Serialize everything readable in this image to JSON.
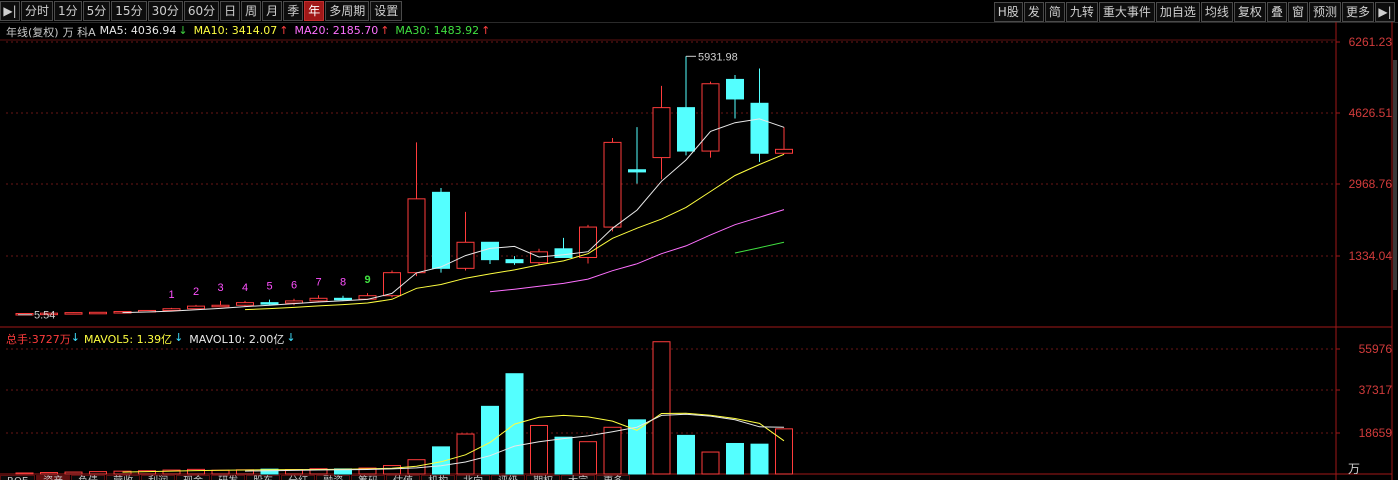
{
  "toolbar": {
    "left": [
      "分时",
      "1分",
      "5分",
      "15分",
      "30分",
      "60分",
      "日",
      "周",
      "月",
      "季",
      "年",
      "多周期",
      "设置"
    ],
    "active": "年",
    "right": [
      "H股",
      "发",
      "简",
      "九转",
      "重大事件",
      "加自选",
      "均线",
      "复权",
      "叠",
      "窗",
      "预测",
      "更多"
    ]
  },
  "main_legend": {
    "label": "年线(复权)",
    "stock": "万 科A",
    "ma": [
      {
        "name": "MA5: ",
        "value": "4036.94",
        "arrow": "↓",
        "color": "#e8e8e8",
        "arrowColor": "#3fd03f"
      },
      {
        "name": "MA10: ",
        "value": "3414.07",
        "arrow": "↑",
        "color": "#ffff40",
        "arrowColor": "#ff4040"
      },
      {
        "name": "MA20: ",
        "value": "2185.70",
        "arrow": "↑",
        "color": "#ff70ff",
        "arrowColor": "#ff4040"
      },
      {
        "name": "MA30: ",
        "value": "1483.92",
        "arrow": "↑",
        "color": "#40e040",
        "arrowColor": "#ff4040"
      }
    ]
  },
  "vol_legend": {
    "label": "总手: ",
    "value": "3727万",
    "items": [
      {
        "name": "MAVOL5: ",
        "value": "1.39亿",
        "arrow": "↓",
        "color": "#ffff40",
        "arrowColor": "#40e0ff"
      },
      {
        "name": "MAVOL10: ",
        "value": "2.00亿",
        "arrow": "↓",
        "color": "#e8e8e8",
        "arrowColor": "#40e0ff"
      }
    ]
  },
  "price_axis": [
    "6261.23",
    "4626.51",
    "2968.76",
    "1334.04"
  ],
  "vol_axis": [
    "55976",
    "37317",
    "18659"
  ],
  "vol_unit": "万",
  "annotations": {
    "high": "5931.98",
    "low": "5.54"
  },
  "counts": [
    "1",
    "2",
    "3",
    "4",
    "5",
    "6",
    "7",
    "8",
    "9"
  ],
  "colors": {
    "up": "#ff3c3c",
    "down": "#54ffff",
    "grid": "#7a1a1a"
  },
  "chart_data": {
    "type": "candlestick",
    "y_axis_ticks": [
      6261.23,
      4626.51,
      2968.76,
      1334.04
    ],
    "ylim": [
      -300,
      6700
    ],
    "candles": [
      {
        "o": 6,
        "h": 12,
        "l": 5.54,
        "c": 10
      },
      {
        "o": 10,
        "h": 22,
        "l": 8,
        "c": 18
      },
      {
        "o": 18,
        "h": 35,
        "l": 15,
        "c": 30
      },
      {
        "o": 30,
        "h": 42,
        "l": 25,
        "c": 38
      },
      {
        "o": 38,
        "h": 60,
        "l": 34,
        "c": 55
      },
      {
        "o": 55,
        "h": 90,
        "l": 50,
        "c": 80
      },
      {
        "o": 80,
        "h": 140,
        "l": 75,
        "c": 120
      },
      {
        "o": 120,
        "h": 210,
        "l": 110,
        "c": 180
      },
      {
        "o": 180,
        "h": 300,
        "l": 160,
        "c": 200
      },
      {
        "o": 200,
        "h": 300,
        "l": 170,
        "c": 260
      },
      {
        "o": 260,
        "h": 330,
        "l": 210,
        "c": 250
      },
      {
        "o": 250,
        "h": 350,
        "l": 200,
        "c": 300
      },
      {
        "o": 300,
        "h": 430,
        "l": 280,
        "c": 360
      },
      {
        "o": 360,
        "h": 420,
        "l": 300,
        "c": 340
      },
      {
        "o": 340,
        "h": 480,
        "l": 330,
        "c": 420
      },
      {
        "o": 420,
        "h": 1000,
        "l": 380,
        "c": 950
      },
      {
        "o": 950,
        "h": 3950,
        "l": 870,
        "c": 2650
      },
      {
        "o": 2800,
        "h": 2900,
        "l": 950,
        "c": 1050
      },
      {
        "o": 1050,
        "h": 2350,
        "l": 1000,
        "c": 1650
      },
      {
        "o": 1650,
        "h": 1600,
        "l": 1150,
        "c": 1250
      },
      {
        "o": 1250,
        "h": 1330,
        "l": 1130,
        "c": 1180
      },
      {
        "o": 1180,
        "h": 1500,
        "l": 1120,
        "c": 1430
      },
      {
        "o": 1500,
        "h": 1750,
        "l": 1380,
        "c": 1300
      },
      {
        "o": 1300,
        "h": 2050,
        "l": 1160,
        "c": 2000
      },
      {
        "o": 2000,
        "h": 4050,
        "l": 1900,
        "c": 3950
      },
      {
        "o": 3320,
        "h": 4300,
        "l": 3000,
        "c": 3270
      },
      {
        "o": 3600,
        "h": 5250,
        "l": 3100,
        "c": 4750
      },
      {
        "o": 4750,
        "h": 5931.98,
        "l": 3650,
        "c": 3750
      },
      {
        "o": 3750,
        "h": 5350,
        "l": 3600,
        "c": 5300
      },
      {
        "o": 5400,
        "h": 5500,
        "l": 4500,
        "c": 4950
      },
      {
        "o": 4850,
        "h": 5650,
        "l": 3500,
        "c": 3700
      },
      {
        "o": 3700,
        "h": 4300,
        "l": 3680,
        "c": 3790
      }
    ],
    "volumes": [
      900,
      1100,
      1300,
      1500,
      1700,
      1900,
      2200,
      2500,
      2100,
      2300,
      2600,
      2400,
      2800,
      2700,
      3100,
      4200,
      6800,
      12500,
      18200,
      30500,
      45000,
      22000,
      16800,
      14800,
      21200,
      24500,
      59200,
      17600,
      10200,
      14000,
      13700,
      20500,
      3727
    ]
  },
  "bottom_tabs": [
    "ROE",
    "资产",
    "负债",
    "营收",
    "利润",
    "现金",
    "研发",
    "股东",
    "分红",
    "融资",
    "筹码",
    "估值",
    "机构",
    "北向",
    "评级",
    "期权",
    "大宗",
    "更多"
  ]
}
